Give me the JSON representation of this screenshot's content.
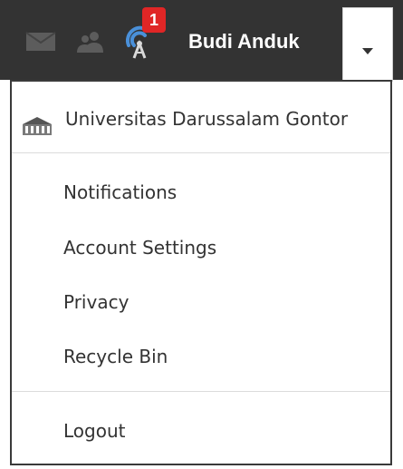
{
  "topbar": {
    "icons": {
      "messages": "envelope-icon",
      "friend_requests": "friends-icon",
      "notifications": "broadcast-icon"
    },
    "notification_count": "1",
    "user_name": "Budi Anduk",
    "menu_toggle_icon": "caret-down-icon"
  },
  "menu": {
    "organization": {
      "label": "Universitas Darussalam Gontor",
      "icon": "building-icon"
    },
    "items": [
      {
        "label": "Notifications"
      },
      {
        "label": "Account Settings"
      },
      {
        "label": "Privacy"
      },
      {
        "label": "Recycle Bin"
      }
    ],
    "logout": {
      "label": "Logout"
    }
  },
  "colors": {
    "topbar_bg": "#333333",
    "badge_bg": "#e02626",
    "notification_icon": "#4a90d9",
    "text": "#333333"
  }
}
